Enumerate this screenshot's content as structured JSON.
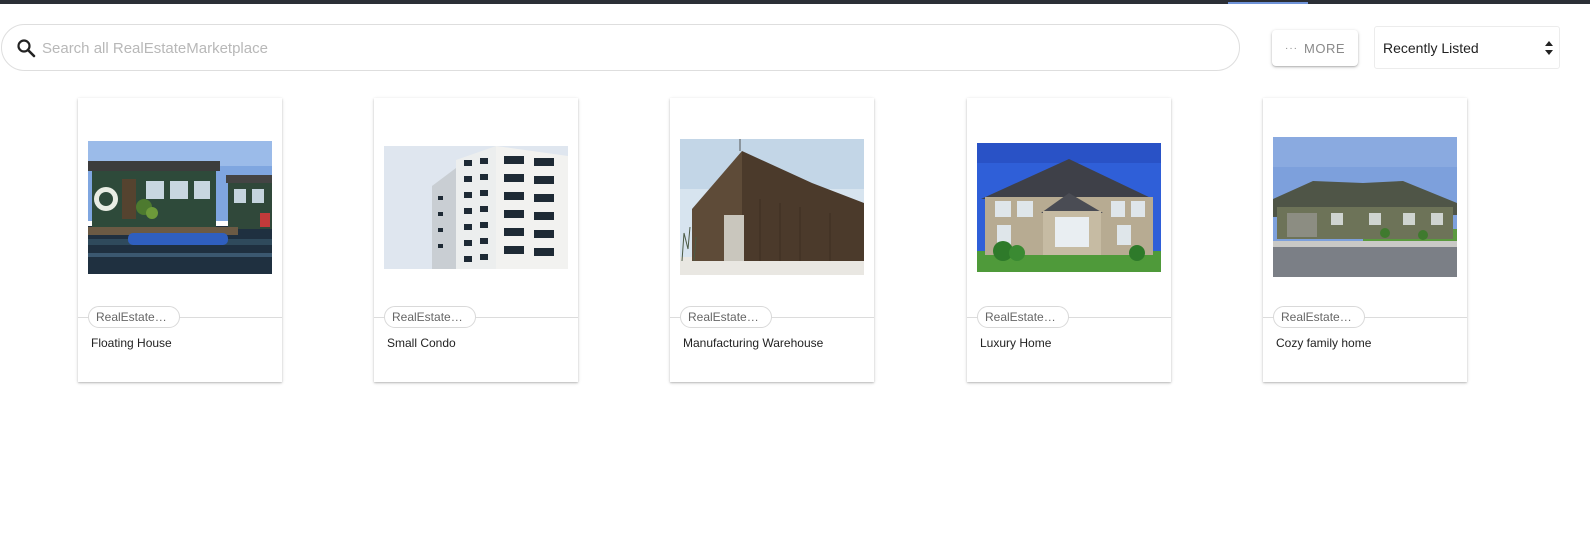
{
  "search": {
    "placeholder": "Search all RealEstateMarketplace",
    "icon": "search-icon"
  },
  "toolbar": {
    "more_dots": "···",
    "more_label": "MORE",
    "sort_value": "Recently Listed"
  },
  "listings": [
    {
      "category": "RealEstate…",
      "title": "Floating House",
      "image": "houseboat"
    },
    {
      "category": "RealEstate…",
      "title": "Small Condo",
      "image": "condo-tower"
    },
    {
      "category": "RealEstate…",
      "title": "Manufacturing Warehouse",
      "image": "warehouse"
    },
    {
      "category": "RealEstate…",
      "title": "Luxury Home",
      "image": "luxury-home"
    },
    {
      "category": "RealEstate…",
      "title": "Cozy family home",
      "image": "family-home"
    }
  ],
  "colors": {
    "accent": "#6f93d8",
    "topbar": "#2b2f36"
  }
}
